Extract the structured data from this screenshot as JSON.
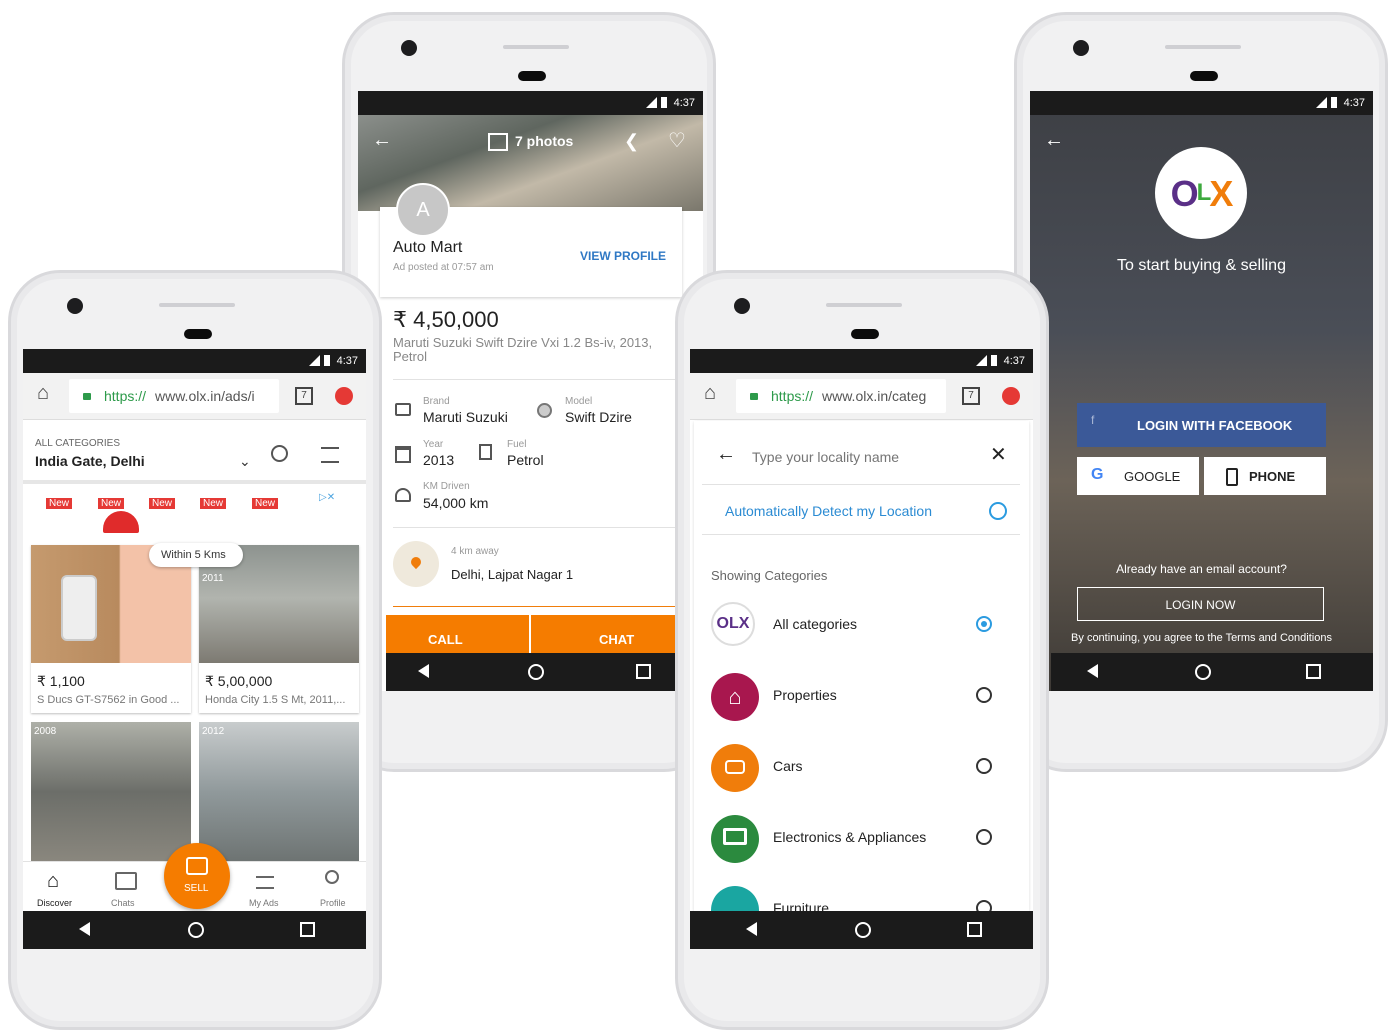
{
  "status": {
    "time": "4:37"
  },
  "phone1": {
    "url_scheme": "https://",
    "url_rest": "www.olx.in/ads/i",
    "tab_count": "7",
    "location_label": "ALL CATEGORIES",
    "location_value": "India Gate, Delhi",
    "banner_tags": [
      "New",
      "New",
      "New",
      "New",
      "New"
    ],
    "tooltip": "Within 5 Kms",
    "listings": [
      {
        "year": "",
        "price": "₹ 1,100",
        "title": "S Ducs GT-S7562 in Good ..."
      },
      {
        "year": "2011",
        "price": "₹ 5,00,000",
        "title": "Honda City 1.5 S Mt, 2011,..."
      },
      {
        "year": "2008",
        "price": "",
        "title": ""
      },
      {
        "year": "2012",
        "price": "",
        "title": ""
      }
    ],
    "bottom_nav": {
      "discover": "Discover",
      "chats": "Chats",
      "sell": "SELL",
      "my_ads": "My Ads",
      "profile": "Profile"
    }
  },
  "phone2": {
    "photos_label": "7 photos",
    "avatar_letter": "A",
    "seller_name": "Auto Mart",
    "posted": "Ad posted at 07:57 am",
    "view_profile": "VIEW PROFILE",
    "price": "₹ 4,50,000",
    "title": "Maruti Suzuki Swift Dzire Vxi 1.2 Bs-iv, 2013, Petrol",
    "specs": {
      "brand_label": "Brand",
      "brand": "Maruti Suzuki",
      "model_label": "Model",
      "model": "Swift Dzire",
      "year_label": "Year",
      "year": "2013",
      "fuel_label": "Fuel",
      "fuel": "Petrol",
      "km_label": "KM Driven",
      "km": "54,000 km"
    },
    "distance": "4 km away",
    "location": "Delhi, Lajpat Nagar 1",
    "call": "CALL",
    "chat": "CHAT"
  },
  "phone3": {
    "url_scheme": "https://",
    "url_rest": "www.olx.in/categ",
    "tab_count": "7",
    "search_placeholder": "Type your locality name",
    "detect_location": "Automatically Detect my Location",
    "showing": "Showing Categories",
    "categories": [
      "All categories",
      "Properties",
      "Cars",
      "Electronics & Appliances",
      "Furniture"
    ],
    "colors": {
      "properties": "#a8174e",
      "cars": "#f07d0b",
      "electronics": "#2b8a3e",
      "furniture": "#1aa6a1",
      "accent": "#2b9be0"
    }
  },
  "phone4": {
    "logo": {
      "o": "O",
      "l": "L",
      "x": "X"
    },
    "tagline": "To start buying & selling",
    "facebook": "LOGIN WITH FACEBOOK",
    "google": "GOOGLE",
    "phone": "PHONE",
    "have_account": "Already have an email account?",
    "login_now": "LOGIN NOW",
    "terms": "By continuing, you agree to the Terms and Conditions"
  }
}
